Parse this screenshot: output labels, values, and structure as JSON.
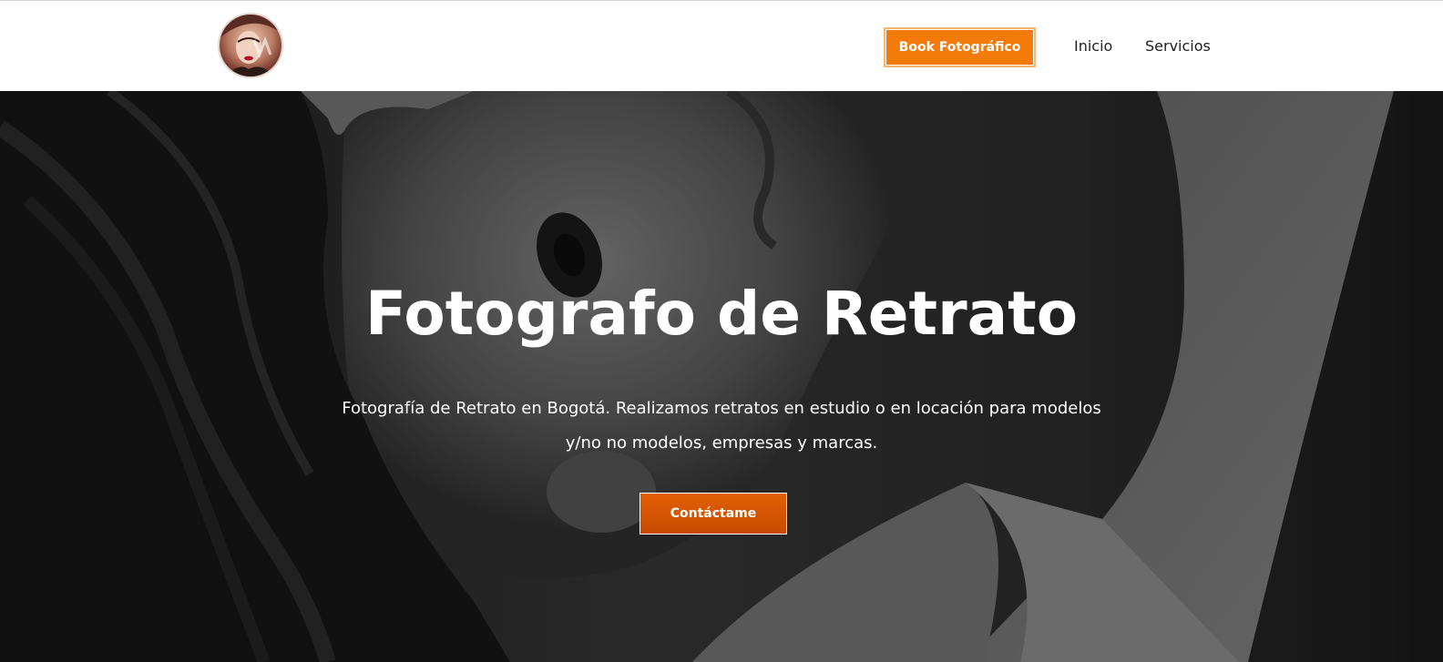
{
  "header": {
    "logo_icon": "portrait-avatar-logo",
    "book_button_label": "Book Fotográfico",
    "nav": {
      "inicio": "Inicio",
      "servicios": "Servicios"
    }
  },
  "hero": {
    "title": "Fotografo de Retrato",
    "subtitle": "Fotografía de Retrato en Bogotá. Realizamos retratos en estudio o en locación para modelos y/no no modelos, empresas y marcas.",
    "cta_label": "Contáctame",
    "background_image": "black-and-white portrait of a woman"
  },
  "colors": {
    "accent_orange": "#f57a0c",
    "cta_orange": "#d45303",
    "header_bg": "#ffffff",
    "text_dark": "#1f1f1f"
  }
}
